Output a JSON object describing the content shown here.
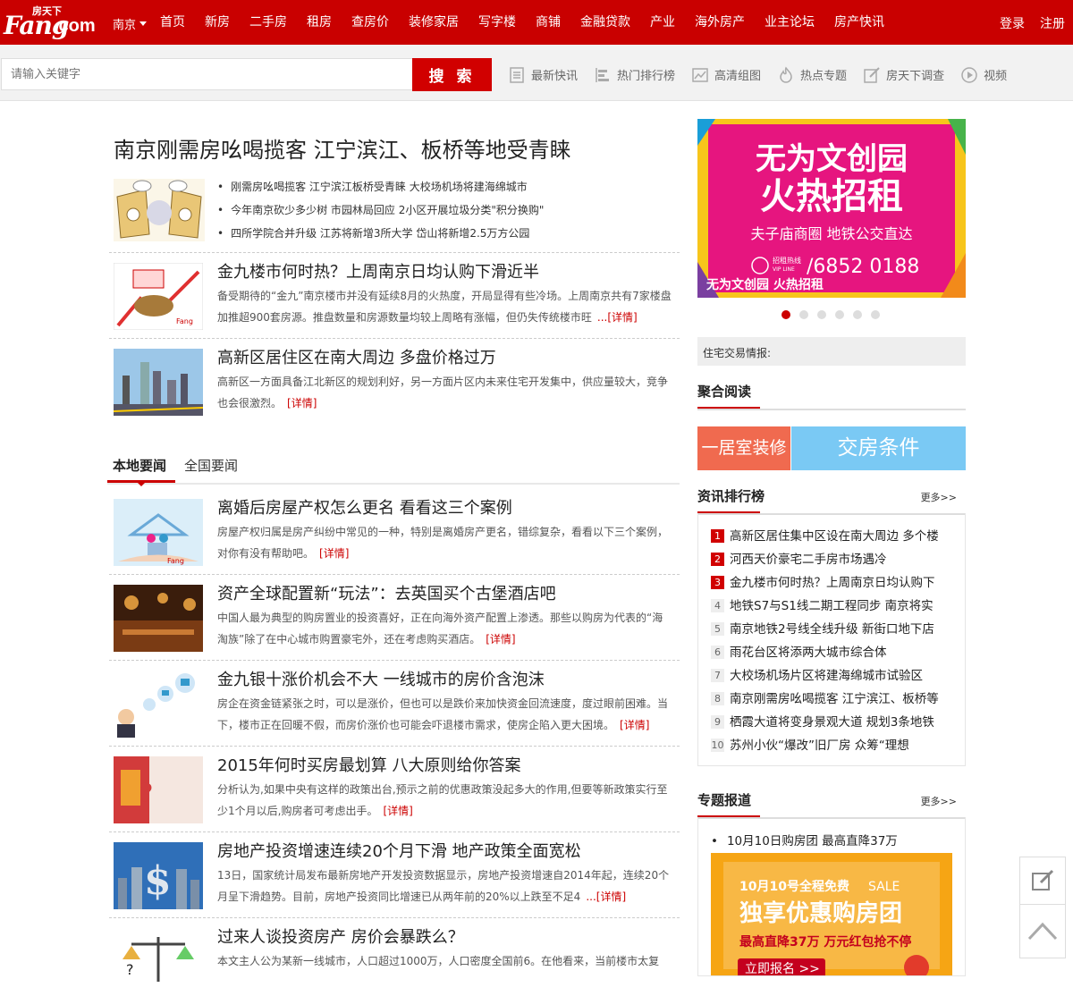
{
  "header": {
    "logo_text_fang": "Fang",
    "logo_text_com": ".com",
    "logo_text_cn": "房天下",
    "city": "南京",
    "nav": [
      "首页",
      "新房",
      "二手房",
      "租房",
      "查房价",
      "装修家居",
      "写字楼",
      "商铺",
      "金融贷款",
      "产业",
      "海外房产",
      "业主论坛",
      "房产快讯"
    ],
    "login": "登录",
    "register": "注册"
  },
  "search": {
    "placeholder": "请输入关键字",
    "button": "搜 索",
    "links": [
      {
        "label": "最新快讯",
        "icon": "list-icon"
      },
      {
        "label": "热门排行榜",
        "icon": "ranking-icon"
      },
      {
        "label": "高清组图",
        "icon": "chart-image-icon"
      },
      {
        "label": "热点专题",
        "icon": "flame-icon"
      },
      {
        "label": "房天下调查",
        "icon": "survey-edit-icon"
      },
      {
        "label": "视频",
        "icon": "play-icon"
      }
    ]
  },
  "main": {
    "headline": "南京刚需房吆喝揽客 江宁滨江、板桥等地受青睐",
    "bullets": [
      "刚需房吆喝揽客 江宁滨江板桥受青睐  大校场机场将建海绵城市",
      "今年南京砍少多少树 市园林局回应  2小区开展垃圾分类\"积分换购\"",
      "四所学院合并升级  江苏将新增3所大学  岱山将新增2.5万方公园"
    ],
    "top_news": [
      {
        "title": "金九楼市何时热？上周南京日均认购下滑近半",
        "summary": "备受期待的“金九”南京楼市并没有延续8月的火热度，开局显得有些冷场。上周南京共有7家楼盘加推超900套房源。推盘数量和房源数量均较上周略有涨幅，但仍失传统楼市旺",
        "detail": "...[详情]"
      },
      {
        "title": "高新区居住区在南大周边 多盘价格过万",
        "summary": "高新区一方面具备江北新区的规划利好，另一方面片区内未来住宅开发集中，供应量较大，竞争也会很激烈。",
        "detail": "[详情]"
      }
    ],
    "tabs": {
      "local": "本地要闻",
      "national": "全国要闻"
    },
    "local_news": [
      {
        "title": "离婚后房屋产权怎么更名 看看这三个案例",
        "summary": "房屋产权归属是房产纠纷中常见的一种，特别是离婚房产更名，错综复杂，看看以下三个案例，对你有没有帮助吧。",
        "detail": "[详情]"
      },
      {
        "title": "资产全球配置新“玩法”：去英国买个古堡酒店吧",
        "summary": "中国人最为典型的购房置业的投资喜好，正在向海外资产配置上渗透。那些以购房为代表的“海淘族”除了在中心城市购置豪宅外，还在考虑购买酒店。",
        "detail": "[详情]"
      },
      {
        "title": "金九银十涨价机会不大 一线城市的房价含泡沫",
        "summary": "房企在资金链紧张之时，可以是涨价，但也可以是跌价来加快资金回流速度，度过眼前困难。当下，楼市正在回暖不假，而房价涨价也可能会吓退楼市需求，使房企陷入更大困境。",
        "detail": "[详情]"
      },
      {
        "title": "2015年何时买房最划算 八大原则给你答案",
        "summary": "分析认为,如果中央有这样的政策出台,预示之前的优惠政策没起多大的作用,但要等新政策实行至少1个月以后,购房者可考虑出手。",
        "detail": "[详情]"
      },
      {
        "title": "房地产投资增速连续20个月下滑 地产政策全面宽松",
        "summary": "13日，国家统计局发布最新房地产开发投资数据显示，房地产投资增速自2014年起，连续20个月呈下滑趋势。目前，房地产投资同比增速已从两年前的20%以上跌至不足4",
        "detail": "...[详情]"
      },
      {
        "title": "过来人谈投资房产 房价会暴跌么？",
        "summary": "本文主人公为某新一线城市，人口超过1000万，人口密度全国前6。在他看来，当前楼市太复",
        "detail": ""
      }
    ]
  },
  "ad": {
    "line1": "无为文创园",
    "line2": "火热招租",
    "line3": "夫子庙商圈 地铁公交直达",
    "hotline_label": "招租热线",
    "hotline_sub": "VIP LINE",
    "phone": "/6852 0188",
    "footer": "无为文创园 火热招租"
  },
  "sidebar": {
    "trade_info": "住宅交易情报:",
    "juhe_title": "聚合阅读",
    "btn_decor": "一居室装修",
    "btn_handover": "交房条件",
    "rank_title": "资讯排行榜",
    "rank_more": "更多>>",
    "rank": [
      {
        "num": "1",
        "text": "高新区居住集中区设在南大周边 多个楼"
      },
      {
        "num": "2",
        "text": "河西天价豪宅二手房市场遇冷"
      },
      {
        "num": "3",
        "text": "金九楼市何时热？上周南京日均认购下"
      },
      {
        "num": "4",
        "text": "地铁S7与S1线二期工程同步 南京将实"
      },
      {
        "num": "5",
        "text": "南京地铁2号线全线升级 新街口地下店"
      },
      {
        "num": "6",
        "text": "雨花台区将添两大城市综合体"
      },
      {
        "num": "7",
        "text": "大校场机场片区将建海绵城市试验区"
      },
      {
        "num": "8",
        "text": "南京刚需房吆喝揽客 江宁滨江、板桥等"
      },
      {
        "num": "9",
        "text": "栖霞大道将变身景观大道 规划3条地铁"
      },
      {
        "num": "10",
        "text": "苏州小伙“爆改”旧厂房 众筹“理想"
      }
    ],
    "topic_title": "专题报道",
    "topic_more": "更多>>",
    "topic_item": "10月10日购房团 最高直降37万",
    "banner": {
      "line1": "10月10号全程免费",
      "sale": "SALE",
      "line2": "独享优惠购房团",
      "line3": "最高直降37万 万元红包抢不停",
      "btn": "立即报名 >>"
    }
  },
  "colors": {
    "brand": "#c90000",
    "accent": "#d10000",
    "ad_pink": "#e6157f",
    "blue": "#7ac9f4",
    "orange": "#f06a4f"
  }
}
